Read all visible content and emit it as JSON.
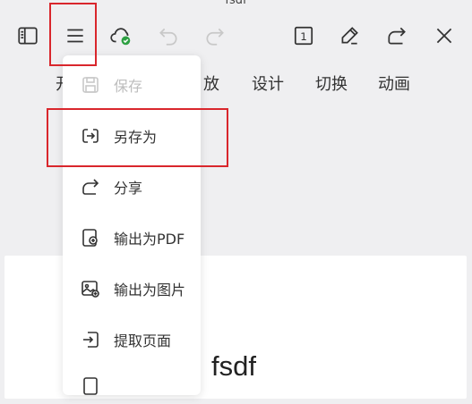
{
  "document": {
    "title": "fsdf"
  },
  "toolbar": {
    "icons": [
      "sidebar-icon",
      "menu-icon",
      "cloud-synced-icon",
      "undo-icon",
      "redo-icon",
      "slide-number-icon",
      "pen-icon",
      "share-icon",
      "close-icon"
    ],
    "slide_number": "1"
  },
  "ribbon": {
    "tabs": [
      {
        "label": "放"
      },
      {
        "label": "设计"
      },
      {
        "label": "切换"
      },
      {
        "label": "动画"
      }
    ],
    "partial_first": "开"
  },
  "menu": {
    "items": [
      {
        "label": "保存",
        "icon": "save-icon",
        "disabled": true
      },
      {
        "label": "另存为",
        "icon": "save-as-icon",
        "disabled": false
      },
      {
        "label": "分享",
        "icon": "share-icon",
        "disabled": false
      },
      {
        "label": "输出为PDF",
        "icon": "export-pdf-icon",
        "disabled": false
      },
      {
        "label": "输出为图片",
        "icon": "export-image-icon",
        "disabled": false
      },
      {
        "label": "提取页面",
        "icon": "extract-page-icon",
        "disabled": false
      }
    ]
  },
  "slide": {
    "text": "fsdf"
  },
  "colors": {
    "highlight": "#d9262c",
    "sync_ok": "#2ea043",
    "disabled": "#bdbdbd"
  }
}
